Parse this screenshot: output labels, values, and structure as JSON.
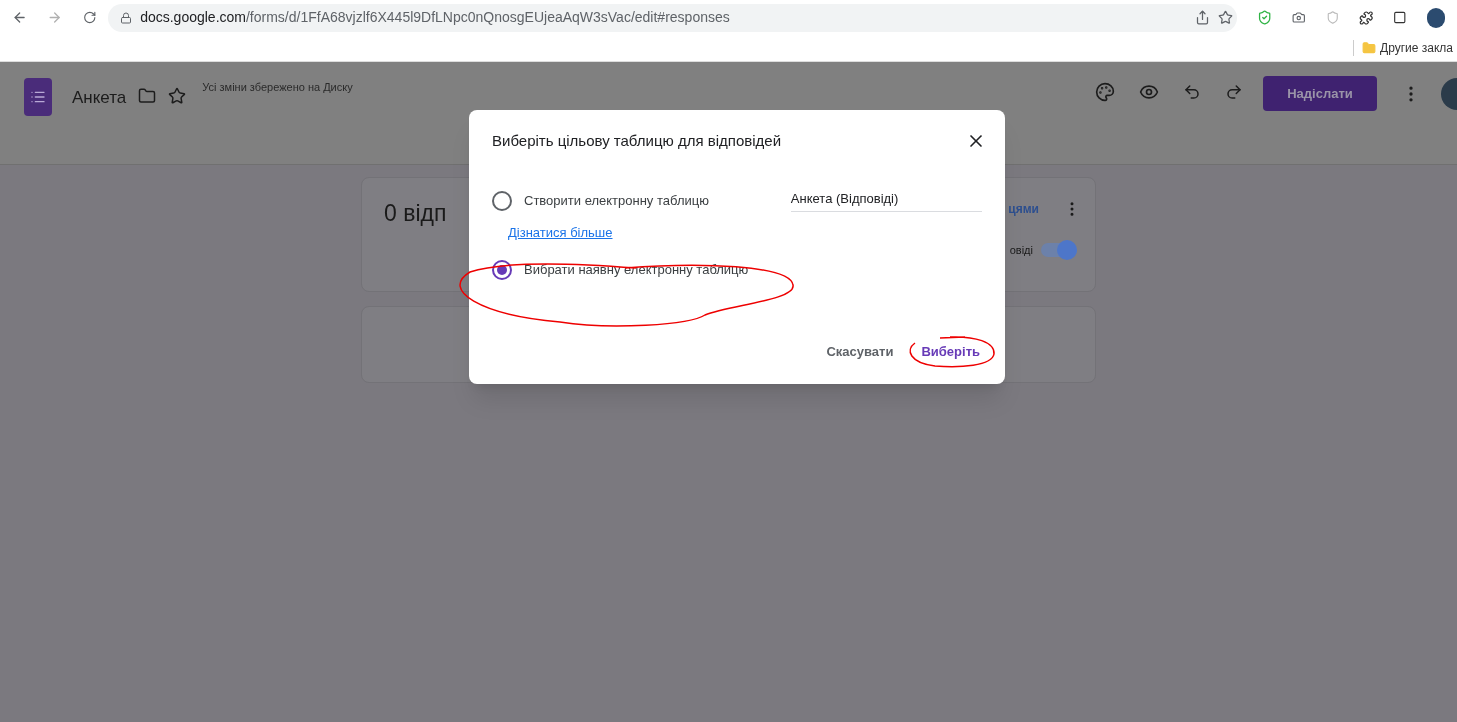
{
  "browser": {
    "url_host": "docs.google.com",
    "url_path": "/forms/d/1FfA68vjzlf6X445l9DfLNpc0nQnosgEUjeaAqW3sVac/edit#responses",
    "bookmark": "Другие закла"
  },
  "header": {
    "title": "Анкета",
    "save_status": "Усі зміни збережено на Диску",
    "send_button": "Надіслати"
  },
  "summary_card": {
    "count_text": "0 відп",
    "link_text": "цями",
    "toggle_label": "овіді",
    "toggle_on": true
  },
  "dialog": {
    "title": "Виберіть цільову таблицю для відповідей",
    "options": [
      {
        "kind": "new",
        "label": "Створити електронну таблицю",
        "selected": false,
        "value": "Анкета (Відповіді)"
      },
      {
        "kind": "link",
        "label": "Дізнатися більше"
      },
      {
        "kind": "existing",
        "label": "Вибрати наявну електронну таблицю",
        "selected": true
      }
    ],
    "cancel": "Скасувати",
    "confirm": "Виберіть"
  }
}
